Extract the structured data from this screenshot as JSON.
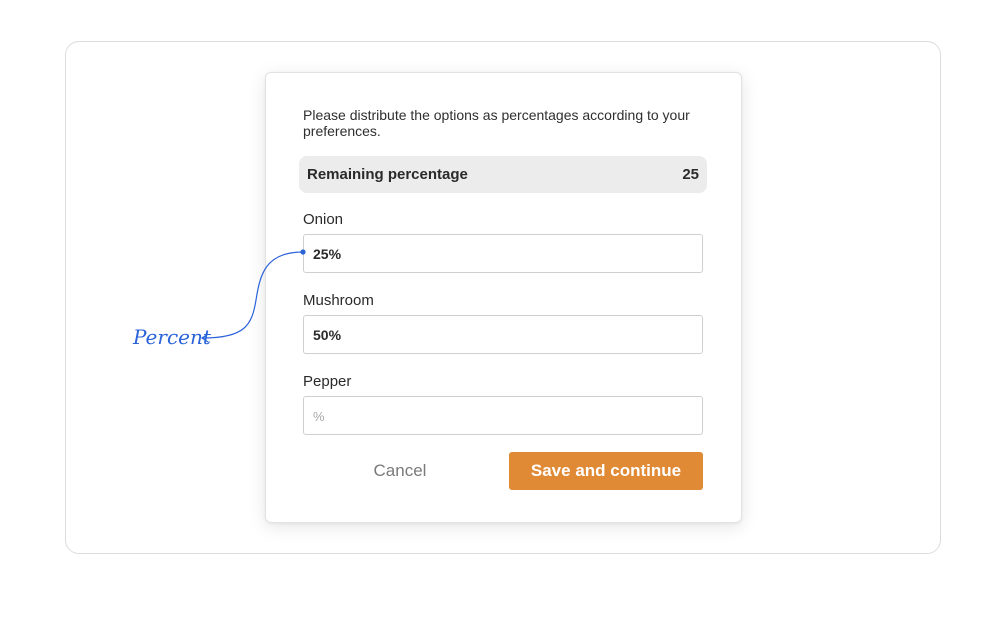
{
  "dialog": {
    "instructions": "Please distribute the options as percentages according to your preferences.",
    "remaining": {
      "label": "Remaining percentage",
      "value": "25"
    },
    "fields": [
      {
        "label": "Onion",
        "value": "25%",
        "placeholder": "%"
      },
      {
        "label": "Mushroom",
        "value": "50%",
        "placeholder": "%"
      },
      {
        "label": "Pepper",
        "value": "",
        "placeholder": "%"
      }
    ],
    "cancel_label": "Cancel",
    "save_label": "Save and continue"
  },
  "annotation": {
    "label": "Percent",
    "color": "#2b63d9"
  },
  "colors": {
    "accent": "#e08a35",
    "remaining_bg": "#ececec"
  }
}
